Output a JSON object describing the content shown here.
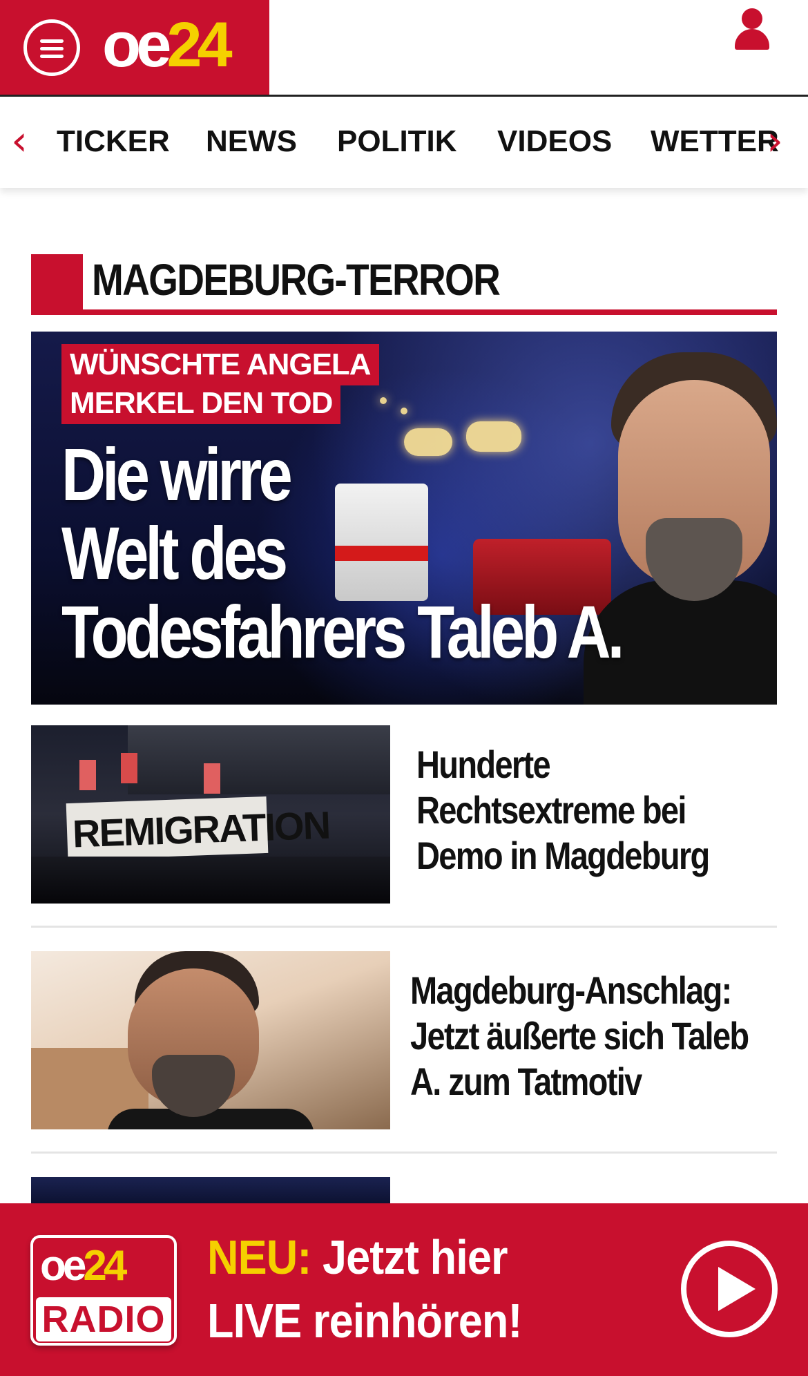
{
  "header": {
    "logo_oe": "oe",
    "logo_num": "24",
    "menu_icon": "hamburger-menu-icon",
    "user_icon": "user-icon",
    "brand_color": "#c8102e",
    "accent_color": "#f5d000"
  },
  "nav": {
    "prev_icon": "chevron-left-icon",
    "next_icon": "chevron-right-icon",
    "items": [
      {
        "label": "TICKER"
      },
      {
        "label": "NEWS"
      },
      {
        "label": "POLITIK"
      },
      {
        "label": "VIDEOS"
      },
      {
        "label": "WETTER"
      }
    ]
  },
  "section": {
    "title": "MAGDEBURG-TERROR"
  },
  "hero": {
    "kicker_line1": "WÜNSCHTE ANGELA",
    "kicker_line2": "MERKEL DEN TOD",
    "headline_line1": "Die wirre",
    "headline_line2": "Welt des",
    "headline_line3": "Todesfahrers Taleb A."
  },
  "articles": [
    {
      "title_line1": "Hunderte",
      "title_line2": "Rechtsextreme bei",
      "title_line3": "Demo in Magdeburg",
      "thumb_text": "REMIGRATION"
    },
    {
      "title_line1": "Magdeburg-Anschlag:",
      "title_line2": "Jetzt äußerte sich Taleb",
      "title_line3": "A. zum Tatmotiv"
    }
  ],
  "radio_banner": {
    "logo_oe": "oe",
    "logo_num": "24",
    "logo_sub": "RADIO",
    "neu_label": "NEU:",
    "line1_rest": " Jetzt hier",
    "line2": "LIVE reinhören!",
    "play_icon": "play-icon"
  }
}
